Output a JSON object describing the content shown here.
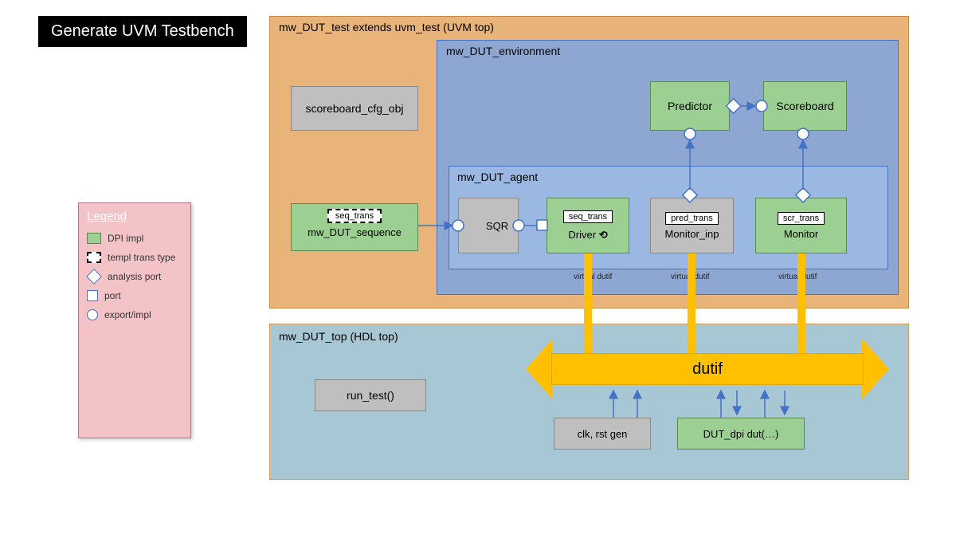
{
  "title": "Generate UVM Testbench",
  "legend": {
    "heading": "Legend",
    "items": {
      "dpi": "DPI impl",
      "templ": "templ trans type",
      "analysis": "analysis port",
      "port": "port",
      "export": "export/impl"
    }
  },
  "uvm_top": {
    "label": "mw_DUT_test extends uvm_test  (UVM top)",
    "scoreboard_cfg": "scoreboard_cfg_obj",
    "environment": {
      "label": "mw_DUT_environment",
      "predictor": "Predictor",
      "scoreboard": "Scoreboard",
      "agent": {
        "label": "mw_DUT_agent",
        "sqr": "SQR",
        "driver": {
          "trans": "seq_trans",
          "label": "Driver"
        },
        "monitor_inp": {
          "trans": "pred_trans",
          "label": "Monitor_inp"
        },
        "monitor": {
          "trans": "scr_trans",
          "label": "Monitor"
        },
        "virtual_dutif": "virtual dutif"
      }
    },
    "sequence": {
      "trans": "seq_trans",
      "label": "mw_DUT_sequence"
    }
  },
  "hdl_top": {
    "label": "mw_DUT_top  (HDL top)",
    "run_test": "run_test()",
    "dutif": "dutif",
    "clk_rst": "clk, rst gen",
    "dut_dpi": "DUT_dpi dut(…)"
  }
}
